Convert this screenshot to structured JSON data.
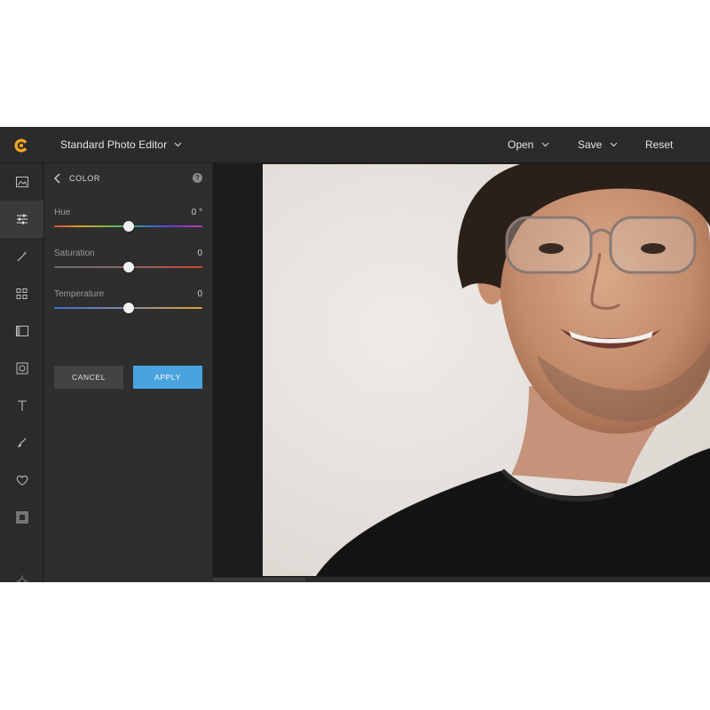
{
  "header": {
    "app_title": "Standard Photo Editor",
    "open_label": "Open",
    "save_label": "Save",
    "reset_label": "Reset"
  },
  "rail": {
    "items": [
      {
        "icon": "image-icon"
      },
      {
        "icon": "sliders-icon",
        "active": true
      },
      {
        "icon": "magic-wand-icon"
      },
      {
        "icon": "grid-icon"
      },
      {
        "icon": "layout-icon"
      },
      {
        "icon": "frame-icon"
      },
      {
        "icon": "text-icon"
      },
      {
        "icon": "brush-icon"
      },
      {
        "icon": "heart-icon"
      },
      {
        "icon": "border-icon"
      },
      {
        "icon": "gear-icon"
      }
    ]
  },
  "panel": {
    "title": "COLOR",
    "help": "?",
    "sliders": [
      {
        "label": "Hue",
        "value": "0 °",
        "position": 0.5
      },
      {
        "label": "Saturation",
        "value": "0",
        "position": 0.5
      },
      {
        "label": "Temperature",
        "value": "0",
        "position": 0.5
      }
    ],
    "cancel_label": "CANCEL",
    "apply_label": "APPLY"
  },
  "colors": {
    "accent": "#4aa3df",
    "logo": "#f5a623",
    "background": "#262626"
  }
}
